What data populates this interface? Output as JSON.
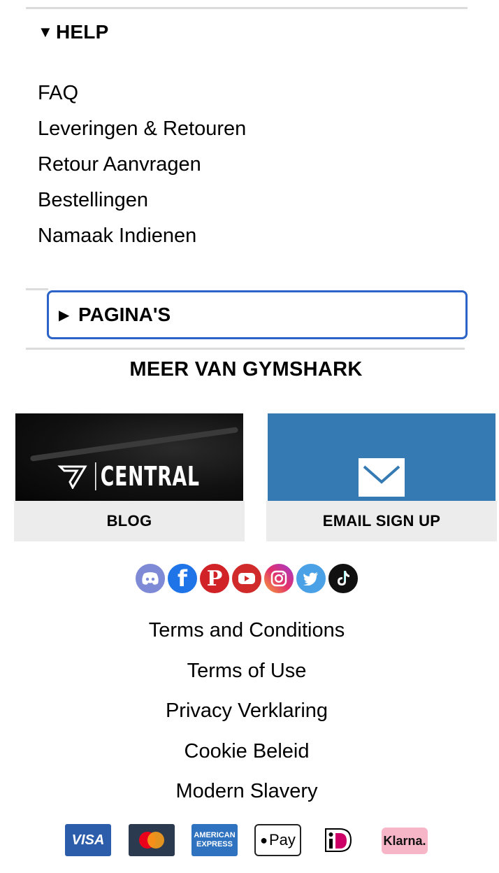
{
  "help": {
    "title": "HELP",
    "links": [
      "FAQ",
      "Leveringen & Retouren",
      "Retour Aanvragen",
      "Bestellingen",
      "Namaak Indienen"
    ]
  },
  "pages": {
    "title": "PAGINA'S"
  },
  "more": {
    "title": "MEER VAN GYMSHARK",
    "blog": {
      "image_text": "CENTRAL",
      "label": "BLOG"
    },
    "email": {
      "label": "EMAIL SIGN UP"
    }
  },
  "social": [
    "discord-icon",
    "facebook-icon",
    "pinterest-icon",
    "youtube-icon",
    "instagram-icon",
    "twitter-icon",
    "tiktok-icon"
  ],
  "legal": [
    "Terms and Conditions",
    "Terms of Use",
    "Privacy Verklaring",
    "Cookie Beleid",
    "Modern Slavery"
  ],
  "payments": {
    "visa": "VISA",
    "amex_line1": "AMERICAN",
    "amex_line2": "EXPRESS",
    "applepay": "Pay",
    "ideal": "iDEAL",
    "klarna": "Klarna."
  },
  "colors": {
    "focus": "#2c63c8",
    "email_bg": "#357ab3",
    "footer_bg": "#ececec"
  }
}
